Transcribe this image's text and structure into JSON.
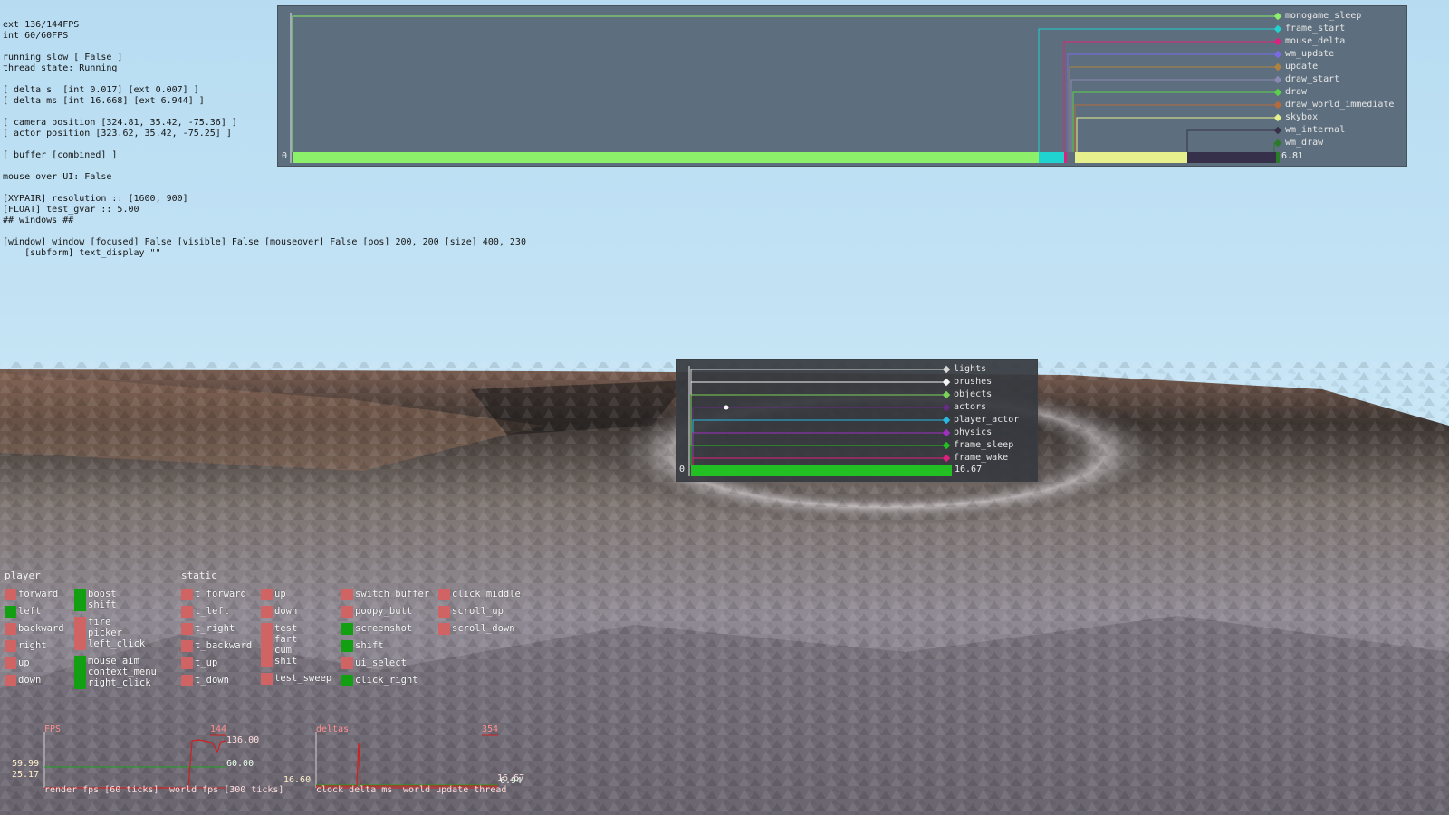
{
  "debug_lines": [
    "ext 136/144FPS",
    "int 60/60FPS",
    "",
    "running slow [ False ]",
    "thread state: Running",
    "",
    "[ delta s  [int 0.017] [ext 0.007] ]",
    "[ delta ms [int 16.668] [ext 6.944] ]",
    "",
    "[ camera position [324.81, 35.42, -75.36] ]",
    "[ actor position [323.62, 35.42, -75.25] ]",
    "",
    "[ buffer [combined] ]",
    "",
    "mouse over UI: False",
    "",
    "[XYPAIR] resolution :: [1600, 900]",
    "[FLOAT] test_gvar :: 5.00",
    "## windows ##",
    "",
    "[window] window [focused] False [visible] False [mouseover] False [pos] 200, 200 [size] 400, 230",
    "    [subform] text_display \"\""
  ],
  "profiler_main": {
    "zero_label": "0",
    "total_label": "6.81",
    "entries": [
      {
        "name": "monogame_sleep",
        "color": "#8cf06a"
      },
      {
        "name": "frame_start",
        "color": "#20d2d0"
      },
      {
        "name": "mouse_delta",
        "color": "#e0207e"
      },
      {
        "name": "wm_update",
        "color": "#7a6ae8"
      },
      {
        "name": "update",
        "color": "#b0823a"
      },
      {
        "name": "draw_start",
        "color": "#8a8ab4"
      },
      {
        "name": "draw",
        "color": "#5ad24a"
      },
      {
        "name": "draw_world_immediate",
        "color": "#b86a3a"
      },
      {
        "name": "skybox",
        "color": "#e6f08c"
      },
      {
        "name": "wm_internal",
        "color": "#36304a"
      },
      {
        "name": "wm_draw",
        "color": "#2a7a2a"
      }
    ]
  },
  "profiler_world": {
    "zero_label": "0",
    "total_label": "16.67",
    "entries": [
      {
        "name": "lights",
        "color": "#d8d8d8"
      },
      {
        "name": "brushes",
        "color": "#f4f4f4"
      },
      {
        "name": "objects",
        "color": "#7ad25a"
      },
      {
        "name": "actors",
        "color": "#6a2a8a"
      },
      {
        "name": "player_actor",
        "color": "#2ab8e0"
      },
      {
        "name": "physics",
        "color": "#a030c0"
      },
      {
        "name": "frame_sleep",
        "color": "#22c022"
      },
      {
        "name": "frame_wake",
        "color": "#e0207e"
      }
    ]
  },
  "inputs": {
    "player_header": "player",
    "static_header": "static",
    "colors": {
      "inactive": "#d06464",
      "active": "#12a012"
    },
    "player_col1": [
      {
        "label": "forward",
        "state": "inactive"
      },
      {
        "label": "left",
        "state": "active"
      },
      {
        "label": "backward",
        "state": "inactive"
      },
      {
        "label": "right",
        "state": "inactive"
      },
      {
        "label": "up",
        "state": "inactive"
      },
      {
        "label": "down",
        "state": "inactive"
      }
    ],
    "player_col2": [
      {
        "label": "boost\nshift",
        "state": "active"
      },
      {
        "label": "fire\npicker\nleft_click",
        "state": "inactive"
      },
      {
        "label": "mouse_aim\ncontext_menu\nright_click",
        "state": "active"
      }
    ],
    "static_col1": [
      {
        "label": "t_forward",
        "state": "inactive"
      },
      {
        "label": "t_left",
        "state": "inactive"
      },
      {
        "label": "t_right",
        "state": "inactive"
      },
      {
        "label": "t_backward",
        "state": "inactive"
      },
      {
        "label": "t_up",
        "state": "inactive"
      },
      {
        "label": "t_down",
        "state": "inactive"
      }
    ],
    "static_col2": [
      {
        "label": "up",
        "state": "inactive"
      },
      {
        "label": "down",
        "state": "inactive"
      },
      {
        "label": "test\nfart\ncum\nshit",
        "state": "inactive"
      },
      {
        "label": "test_sweep",
        "state": "inactive"
      }
    ],
    "static_col3": [
      {
        "label": "switch_buffer",
        "state": "inactive"
      },
      {
        "label": "poopy_butt",
        "state": "inactive"
      },
      {
        "label": "screenshot",
        "state": "active"
      },
      {
        "label": "shift",
        "state": "active"
      },
      {
        "label": "ui_select",
        "state": "inactive"
      },
      {
        "label": "click_right",
        "state": "active"
      }
    ],
    "static_col4": [
      {
        "label": "click_middle",
        "state": "inactive"
      },
      {
        "label": "scroll_up",
        "state": "inactive"
      },
      {
        "label": "scroll_down",
        "state": "inactive"
      }
    ]
  },
  "graph_fps": {
    "title": "FPS",
    "peak_label": "144",
    "current_label": "136.00",
    "mid_label": "60.00",
    "left_top": "59.99",
    "left_bottom": "25.17",
    "legend_render": "render fps [60 ticks]",
    "legend_world": "world fps [300 ticks]",
    "colors": {
      "render": "#d02020",
      "world": "#20a020"
    }
  },
  "graph_deltas": {
    "title": "deltas",
    "peak_label": "354",
    "right_label_a": "16.67",
    "right_label_b": "6.94",
    "left_label": "16.60",
    "legend_clock": "clock delta ms",
    "legend_world": "world update thread",
    "colors": {
      "clock": "#d02020",
      "world": "#20a020"
    }
  }
}
